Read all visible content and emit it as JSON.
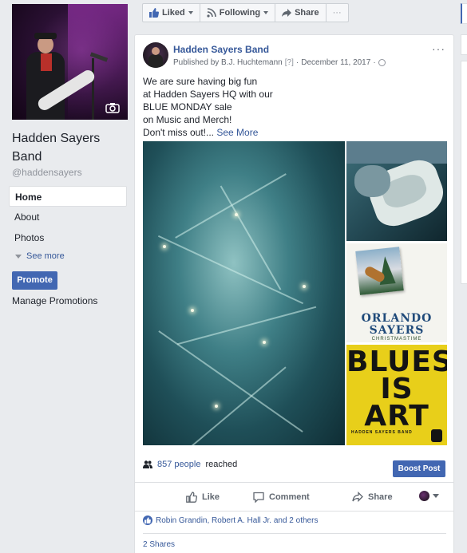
{
  "page": {
    "name": "Hadden Sayers Band",
    "handle": "@haddensayers"
  },
  "nav": {
    "items": [
      {
        "label": "Home",
        "active": true
      },
      {
        "label": "About",
        "active": false
      },
      {
        "label": "Photos",
        "active": false
      }
    ],
    "see_more": "See more",
    "promote": "Promote",
    "manage_promotions": "Manage Promotions"
  },
  "actions_bar": {
    "liked": "Liked",
    "following": "Following",
    "share": "Share",
    "more": "···"
  },
  "post": {
    "author": "Hadden Sayers Band",
    "published_by": "Published by B.J. Huchtemann",
    "help": "[?]",
    "date": "December 11, 2017",
    "separator": "·",
    "more": "···",
    "text_lines": [
      "We are sure having big fun",
      "at Hadden Sayers HQ with our",
      "BLUE MONDAY sale",
      "on Music and Merch!",
      "Don't miss out!..."
    ],
    "see_more": "See More",
    "album": {
      "title_line1": "ORLANDO",
      "title_line2": "SAYERS",
      "subtitle": "CHRISTMASTIME"
    },
    "poster": {
      "lines": [
        "BLUES",
        "IS",
        "ART"
      ],
      "footer": "HADDEN SAYERS BAND"
    },
    "reach_count": "857 people",
    "reach_suffix": "reached",
    "boost": "Boost Post",
    "like": "Like",
    "comment": "Comment",
    "share": "Share",
    "likes_summary": "Robin Grandin, Robert A. Hall Jr. and 2 others",
    "shares": "2 Shares"
  },
  "colors": {
    "brand": "#4267b2",
    "link": "#365899",
    "poster_yellow": "#e8cf1a"
  }
}
